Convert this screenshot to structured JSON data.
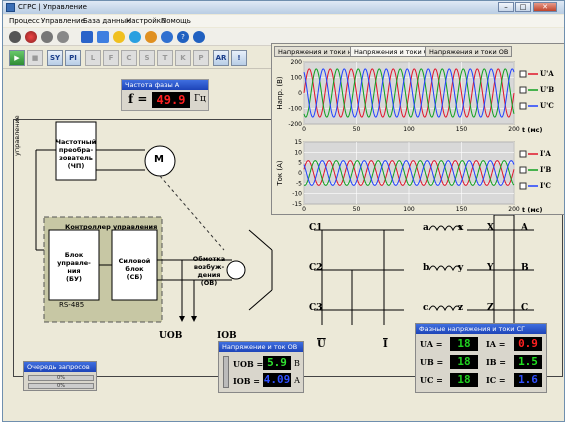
{
  "window": {
    "title": "СГРС | Управление"
  },
  "menu": [
    "Процесс",
    "Управление",
    "База данных",
    "Настройка",
    "Помощь"
  ],
  "toolbar": {
    "buttons": [
      "▶",
      "■",
      "SY",
      "PI",
      "L",
      "F",
      "C",
      "S",
      "T",
      "K",
      "P",
      "AR",
      "!",
      "1",
      "2",
      "I",
      "G",
      "I",
      "I"
    ]
  },
  "freq": {
    "title": "Частота фазы А",
    "symbol": "f =",
    "value": "49.9",
    "unit": "Гц"
  },
  "plots": {
    "tabs": [
      "Напряжения и токи нач.",
      "Напряжения и токи СГ",
      "Напряжения и токи ОВ"
    ],
    "voltage": {
      "ylabel": "Напр. (В)",
      "xlabel": "t (мс)",
      "ticks_y": [
        "200",
        "100",
        "0",
        "-100",
        "-200"
      ],
      "ticks_x": [
        "0",
        "50",
        "100",
        "150",
        "200"
      ],
      "legend": [
        "U'A",
        "U'B",
        "U'C"
      ]
    },
    "current": {
      "ylabel": "Ток (А)",
      "xlabel": "t (мс)",
      "ticks_y": [
        "15",
        "10",
        "5",
        "0",
        "-5",
        "-10",
        "-15"
      ],
      "ticks_x": [
        "0",
        "50",
        "100",
        "150",
        "200"
      ],
      "legend": [
        "I'A",
        "I'B",
        "I'C"
      ]
    },
    "colors": {
      "A": "#e0152b",
      "B": "#10a020",
      "C": "#2040ff"
    }
  },
  "schematic": {
    "fc_label": "Частотный преобра-зователь (ЧП)",
    "fc_lines": [
      "Частотный",
      "преобра-",
      "зователь",
      "(ЧП)"
    ],
    "motor": "M",
    "control": "управление",
    "controller": "Контроллер управления",
    "bu_lines": [
      "Блок",
      "управле-",
      "ния",
      "(БУ)"
    ],
    "sb_lines": [
      "Силовой",
      "блок",
      "(СБ)"
    ],
    "rs": "RS-485",
    "ov_lines": [
      "Обмотка",
      "возбуж-",
      "дения",
      "(ОВ)"
    ],
    "nodes": [
      "C1",
      "C2",
      "C3"
    ],
    "trans": [
      "a",
      "x",
      "b",
      "y",
      "c",
      "z",
      "X",
      "A",
      "Y",
      "B",
      "Z",
      "C"
    ],
    "uob": "UОВ",
    "iob": "IОВ",
    "u": "U",
    "i": "I"
  },
  "queue": {
    "title": "Очередь запросов",
    "bars": [
      "0%",
      "0%"
    ]
  },
  "iob_panel": {
    "title": "Напряжение и ток ОВ",
    "u_label": "UОВ =",
    "u_value": "5.9",
    "u_unit": "В",
    "i_label": "IОВ =",
    "i_value": "4.09",
    "i_unit": "А"
  },
  "phase_panel": {
    "title": "Фазные напряжения и токи СГ",
    "rows": [
      {
        "u_label": "UA =",
        "u_value": "18",
        "i_label": "IA =",
        "i_value": "0.9",
        "i_color": "#ff2020"
      },
      {
        "u_label": "UB =",
        "u_value": "18",
        "i_label": "IB =",
        "i_value": "1.5",
        "i_color": "#20e020"
      },
      {
        "u_label": "UC =",
        "u_value": "18",
        "i_label": "IC =",
        "i_value": "1.6",
        "i_color": "#3050ff"
      }
    ],
    "u_color": "#20d020"
  }
}
